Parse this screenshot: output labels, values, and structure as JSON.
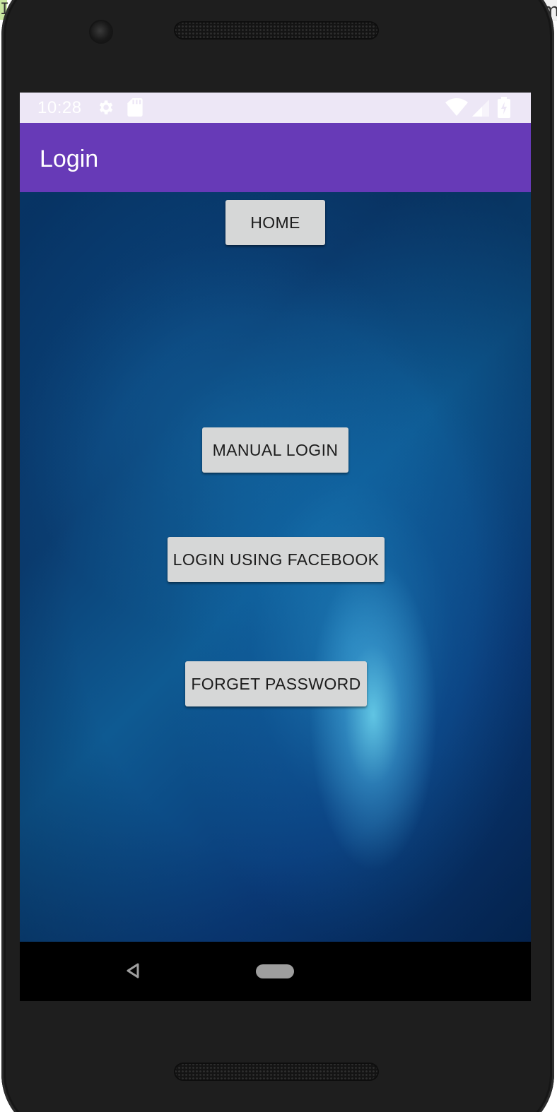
{
  "corner": {
    "left_text": "I",
    "right_text": "m"
  },
  "status_bar": {
    "time": "10:28",
    "icons": [
      "settings-gear-icon",
      "sd-card-icon",
      "wifi-icon",
      "cell-signal-icon",
      "battery-charging-icon"
    ]
  },
  "app_bar": {
    "title": "Login"
  },
  "buttons": {
    "home": "HOME",
    "manual_login": "MANUAL LOGIN",
    "facebook_login": "LOGIN USING FACEBOOK",
    "forget_password": "FORGET PASSWORD"
  },
  "nav_bar": {
    "icons": [
      "back-icon",
      "home-pill-icon"
    ]
  },
  "colors": {
    "app_bar": "#673ab7",
    "status_bar": "#ede7f6",
    "button_bg": "#d6d7d7",
    "content_bg": "#0b4a86"
  }
}
